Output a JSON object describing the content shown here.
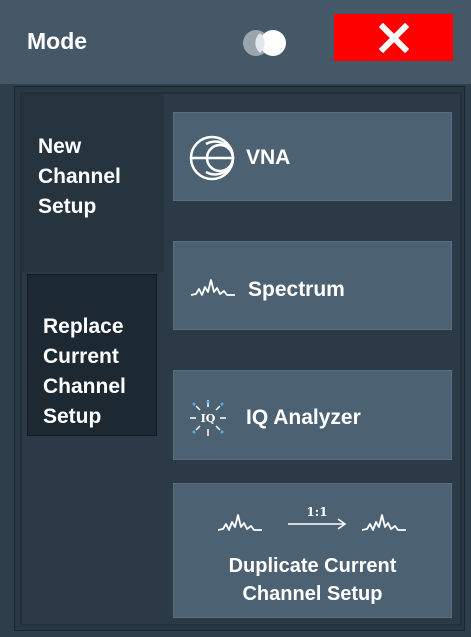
{
  "window": {
    "title": "Mode",
    "toggle_icon": "toggle-circles-icon",
    "close_icon": "close-x-icon",
    "close_color": "#ff0000"
  },
  "tabs": [
    {
      "lines": [
        "New",
        "Channel",
        "Setup"
      ],
      "selected": true
    },
    {
      "lines": [
        "Replace",
        "Current",
        "Channel",
        "Setup"
      ],
      "selected": false
    }
  ],
  "buttons": {
    "vna": {
      "label": "VNA",
      "icon": "smith-chart-icon"
    },
    "spectrum": {
      "label": "Spectrum",
      "icon": "spectrum-trace-icon"
    },
    "iq": {
      "label": "IQ Analyzer",
      "icon": "iq-analyzer-icon"
    },
    "duplicate": {
      "lines": [
        "Duplicate Current",
        "Channel Setup"
      ],
      "ratio": "1:1",
      "icon": "duplicate-spectrum-icon"
    }
  },
  "colors": {
    "titlebar": "#445868",
    "button": "#4c6272",
    "selected_tab": "#263440",
    "unselected_tab": "#1d2932"
  }
}
